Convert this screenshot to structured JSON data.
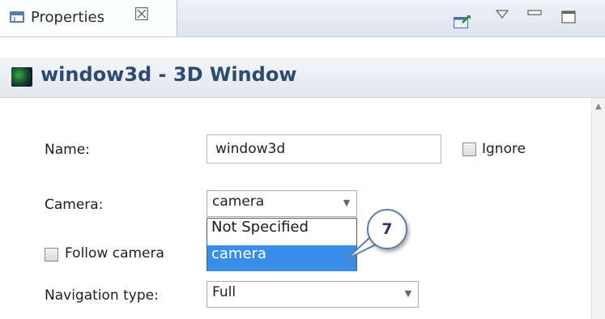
{
  "tab": {
    "title": "Properties",
    "close_icon": "close-icon"
  },
  "header": {
    "title": "window3d - 3D Window"
  },
  "form": {
    "name_label": "Name:",
    "name_value": "window3d",
    "ignore_label": "Ignore",
    "camera_label": "Camera:",
    "camera_value": "camera",
    "follow_camera_label": "Follow camera",
    "navigation_label": "Navigation type:",
    "navigation_value": "Full"
  },
  "camera_dropdown": {
    "options": [
      "Not Specified",
      "camera"
    ],
    "selected_index": 1
  },
  "callout": {
    "number": "7"
  },
  "colors": {
    "title_text": "#2d4a73",
    "selection": "#3b8ee8",
    "callout_border": "#5d7fa8"
  }
}
